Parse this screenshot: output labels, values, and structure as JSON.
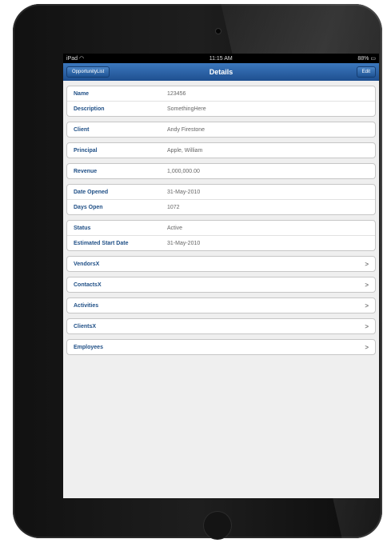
{
  "status_bar": {
    "carrier": "iPad",
    "time": "11:15 AM",
    "battery": "88%"
  },
  "nav": {
    "back_label": "OpportunityList",
    "title": "Details",
    "edit_label": "Edit"
  },
  "details": {
    "name": {
      "label": "Name",
      "value": "123456"
    },
    "description": {
      "label": "Description",
      "value": "SomethingHere"
    },
    "client": {
      "label": "Client",
      "value": "Andy Firestone"
    },
    "principal": {
      "label": "Principal",
      "value": "Apple, William"
    },
    "revenue": {
      "label": "Revenue",
      "value": "1,000,000.00"
    },
    "date_opened": {
      "label": "Date Opened",
      "value": "31-May-2010"
    },
    "days_open": {
      "label": "Days Open",
      "value": "1072"
    },
    "status": {
      "label": "Status",
      "value": "Active"
    },
    "est_start": {
      "label": "Estimated Start Date",
      "value": "31-May-2010"
    }
  },
  "links": [
    "VendorsX",
    "ContactsX",
    "Activities",
    "ClientsX",
    "Employees"
  ],
  "icons": {
    "wifi": "wifi-icon",
    "battery": "battery-icon",
    "chevron": "chevron-right-icon"
  },
  "colors": {
    "navbar": "#2a62a8",
    "label": "#1f4f86"
  }
}
